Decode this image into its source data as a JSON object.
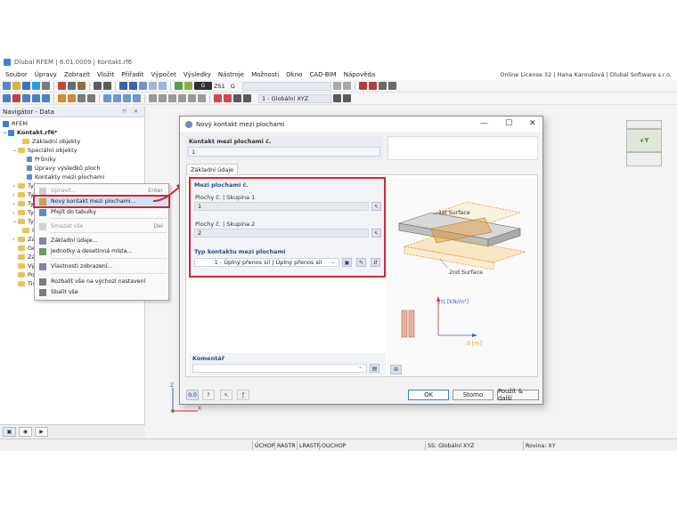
{
  "window": {
    "title": "Dlubal RFEM | 6.01.0009 | Kontakt.rf6",
    "license": "Online License 32 | Hana Karoušová | Dlubal Software s.r.o."
  },
  "menu": [
    "Soubor",
    "Úpravy",
    "Zobrazit",
    "Vložit",
    "Přiřadit",
    "Výpočet",
    "Výsledky",
    "Nástroje",
    "Možnosti",
    "Okno",
    "CAD-BIM",
    "Nápověda"
  ],
  "toolbar": {
    "load_case_code": "G",
    "load_case_label": "ZS1",
    "load_case_type": "G",
    "coord_system": "1 - Globální XYZ"
  },
  "navigator": {
    "title": "Navigátor - Data",
    "root": "RFEM",
    "model": "Kontakt.rf6*",
    "items": [
      {
        "label": "Základní objekty",
        "level": 2,
        "expander": ""
      },
      {
        "label": "Speciální objekty",
        "level": 1,
        "expander": "−"
      },
      {
        "label": "Průniky",
        "level": 3,
        "expander": ""
      },
      {
        "label": "Úpravy výsledků ploch",
        "level": 3,
        "expander": ""
      },
      {
        "label": "Kontakty mezi plochami",
        "level": 3,
        "expander": ""
      },
      {
        "label": "Typy",
        "level": 1,
        "expander": "›"
      },
      {
        "label": "Typy",
        "level": 1,
        "expander": "›"
      },
      {
        "label": "Typy",
        "level": 1,
        "expander": "›"
      },
      {
        "label": "Typy",
        "level": 1,
        "expander": "›"
      },
      {
        "label": "Typy",
        "level": 1,
        "expander": "−"
      },
      {
        "label": "Impe",
        "level": 2,
        "expander": ""
      },
      {
        "label": "Zatíž",
        "level": 1,
        "expander": "›"
      },
      {
        "label": "Generátor zatížení",
        "level": 1,
        "expander": ""
      },
      {
        "label": "Zatížení",
        "level": 1,
        "expander": ""
      },
      {
        "label": "Výsledky",
        "level": 1,
        "expander": ""
      },
      {
        "label": "Pomocné objekty",
        "level": 1,
        "expander": ""
      },
      {
        "label": "Tiskové protokoly",
        "level": 1,
        "expander": ""
      }
    ]
  },
  "context_menu": {
    "items": [
      {
        "label": "Upravit...",
        "shortcut": "Enter",
        "disabled": true
      },
      {
        "label": "Nový kontakt mezi plochami...",
        "shortcut": "",
        "disabled": false,
        "highlighted": true
      },
      {
        "label": "Přejít do tabulky",
        "shortcut": "",
        "disabled": false
      },
      {
        "label": "Smazat vše",
        "shortcut": "Del",
        "disabled": true
      },
      {
        "label": "Základní údaje...",
        "shortcut": "",
        "disabled": false
      },
      {
        "label": "Jednotky a desetinná místa...",
        "shortcut": "",
        "disabled": false
      },
      {
        "label": "Vlastnosti zobrazení...",
        "shortcut": "",
        "disabled": false
      },
      {
        "label": "Rozbalit vše na výchozí nastavení",
        "shortcut": "",
        "disabled": false
      },
      {
        "label": "Sbalit vše",
        "shortcut": "",
        "disabled": false
      }
    ]
  },
  "dialog": {
    "title": "Nový kontakt mezi plochami",
    "number_label": "Kontakt mezi plochami č.",
    "number_value": "1",
    "tab": "Základní údaje",
    "section_label": "Mezi plochami č.",
    "surfaces_group1_label": "Plochy č. | Skupina 1",
    "surfaces_group1_value": "1",
    "surfaces_group2_label": "Plochy č. | Skupina 2",
    "surfaces_group2_value": "2",
    "contact_type_label": "Typ kontaktu mezi plochami",
    "contact_type_value": "1 - Úplný přenos sil | Úplný přenos sil",
    "comment_label": "Komentář",
    "comment_value": "",
    "diagram": {
      "surface1_label": "1st Surface",
      "surface2_label": "2nd Surface",
      "tau_axis_label": "|τ| [kN/m²]",
      "delta_axis_label": "δ [m]"
    },
    "buttons": {
      "ok": "OK",
      "cancel": "Storno",
      "apply_next": "Použít & další"
    }
  },
  "statusbar": {
    "toggles": [
      "ÚCHOP",
      "RASTR",
      "LRASTR",
      "OUCHOP"
    ],
    "cs": "SS: Globální XYZ",
    "plane": "Rovina: XY"
  },
  "viewport": {
    "axis_x": "X",
    "axis_z": "Z",
    "cube_label": "+Y"
  },
  "colors": {
    "highlight": "#d22630",
    "accent": "#e39b2a",
    "selection": "#cfe3f8"
  }
}
